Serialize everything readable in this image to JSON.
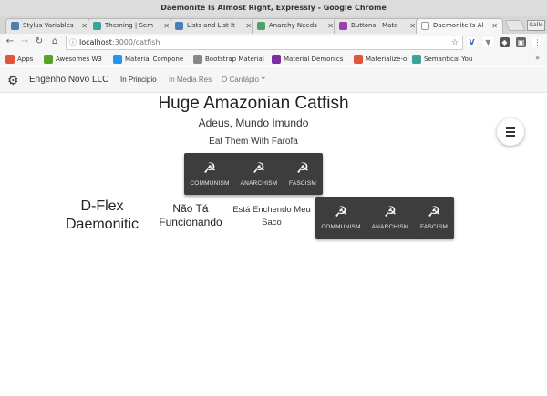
{
  "window": {
    "title": "Daemonite Is Almost Right, Expressly - Google Chrome"
  },
  "tabs": [
    {
      "label": "Stylus Variables",
      "favicon_color": "#4a7fb5"
    },
    {
      "label": "Theming | Sem",
      "favicon_color": "#3aa39a"
    },
    {
      "label": "Lists and List It",
      "favicon_color": "#4a7fb5"
    },
    {
      "label": "Anarchy Needs",
      "favicon_color": "#4aa36a"
    },
    {
      "label": "Buttons - Mate",
      "favicon_color": "#9b3fb0"
    },
    {
      "label": "Daemonite Is Al",
      "favicon_color": "#ffffff"
    }
  ],
  "profile_label": "Gallo",
  "address": {
    "host": "localhost",
    "path": ":3000/catfish"
  },
  "bookmarks": [
    {
      "label": "Apps",
      "icon_color": "#e0533d"
    },
    {
      "label": "Awesomes W3",
      "icon_color": "#5aa02c"
    },
    {
      "label": "Material Compone",
      "icon_color": "#2196f3"
    },
    {
      "label": "Bootstrap Material",
      "icon_color": "#888888"
    },
    {
      "label": "Material Demonics",
      "icon_color": "#7b2fa0"
    },
    {
      "label": "Materialize-o",
      "icon_color": "#e0533d"
    },
    {
      "label": "Semantical You",
      "icon_color": "#3aa39a"
    }
  ],
  "navbar": {
    "brand": "Engenho Novo LLC",
    "links": [
      "In Principio",
      "In Media Res",
      "O Cardápio"
    ]
  },
  "main": {
    "title": "Huge Amazonian Catfish",
    "subtitle": "Adeus, Mundo Imundo",
    "subtitle2": "Eat Them With Farofa",
    "toolbar_top": [
      "COMMUNISM",
      "ANARCHISM",
      "FASCISM"
    ],
    "toolbar_bottom": [
      "COMMUNISM",
      "ANARCHISM",
      "FASCISM"
    ],
    "dflex": "D-Flex Daemonitic",
    "nao": "Não Tá Funcionando",
    "esta": "Está Enchendo Meu Saco"
  }
}
